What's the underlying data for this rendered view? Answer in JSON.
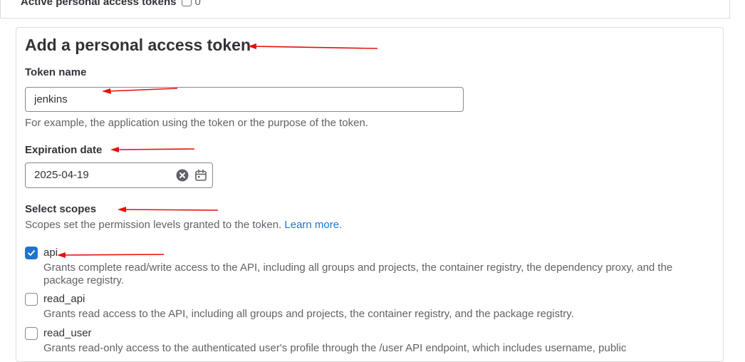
{
  "top_panel": {
    "label": "Active personal access tokens",
    "count": "0"
  },
  "form": {
    "title": "Add a personal access token",
    "token_name": {
      "label": "Token name",
      "value": "jenkins",
      "help": "For example, the application using the token or the purpose of the token."
    },
    "expiration": {
      "label": "Expiration date",
      "value": "2025-04-19"
    },
    "scopes": {
      "label": "Select scopes",
      "help": "Scopes set the permission levels granted to the token.",
      "learn_more": "Learn more.",
      "items": [
        {
          "name": "api",
          "checked": true,
          "desc": "Grants complete read/write access to the API, including all groups and projects, the container registry, the dependency proxy, and the package registry."
        },
        {
          "name": "read_api",
          "checked": false,
          "desc": "Grants read access to the API, including all groups and projects, the container registry, and the package registry."
        },
        {
          "name": "read_user",
          "checked": false,
          "desc": "Grants read-only access to the authenticated user's profile through the /user API endpoint, which includes username, public"
        }
      ]
    }
  },
  "colors": {
    "arrow": "#e3120b",
    "accent": "#1f75cb"
  },
  "icons": [
    "count-icon",
    "clear-icon",
    "calendar-icon",
    "check-icon"
  ]
}
